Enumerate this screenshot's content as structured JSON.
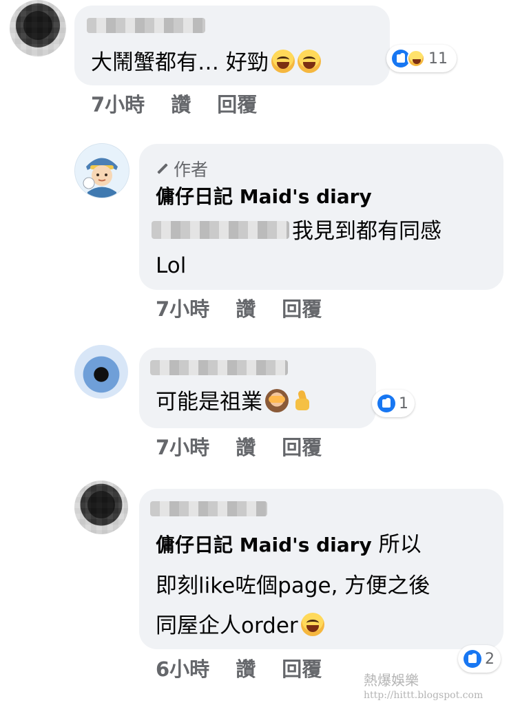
{
  "comments": [
    {
      "text": "大鬧蟹都有… 好勁",
      "reactions": {
        "count": "11"
      },
      "actions": {
        "time": "7小時",
        "like": "讚",
        "reply": "回覆"
      }
    },
    {
      "author_badge": "作者",
      "author": "傭仔日記 Maid's diary",
      "text_line1": "我見到都有同感",
      "text_line2": "Lol",
      "actions": {
        "time": "7小時",
        "like": "讚",
        "reply": "回覆"
      }
    },
    {
      "text": "可能是祖業",
      "reactions": {
        "count": "1"
      },
      "actions": {
        "time": "7小時",
        "like": "讚",
        "reply": "回覆"
      }
    },
    {
      "mention": "傭仔日記 Maid's diary",
      "text_line1_suffix": " 所以",
      "text_line2": "即刻like咗個page, 方便之後",
      "text_line3": "同屋企人order",
      "reactions": {
        "count": "2"
      },
      "actions": {
        "time": "6小時",
        "like": "讚",
        "reply": "回覆"
      }
    }
  ],
  "watermark": {
    "title": "熱爆娛樂",
    "url": "http://hittt.blogspot.com"
  },
  "colors": {
    "bubble": "#f0f2f5",
    "secondary_text": "#65676b",
    "like_blue": "#1877f2"
  }
}
